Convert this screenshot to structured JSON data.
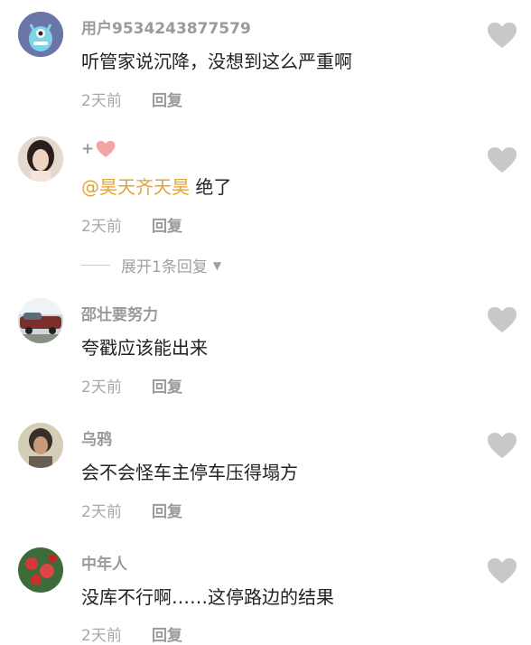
{
  "comments": [
    {
      "username": "用户9534243877579",
      "text": "听管家说沉降，没想到这么严重啊",
      "time": "2天前",
      "reply": "回复"
    },
    {
      "username": "+",
      "mention": "@昊天齐天昊",
      "text": " 绝了",
      "time": "2天前",
      "reply": "回复",
      "expand": "展开1条回复"
    },
    {
      "username": "邵壮要努力",
      "text": "夸戳应该能出来",
      "time": "2天前",
      "reply": "回复"
    },
    {
      "username": "乌鸦",
      "text": "会不会怪车主停车压得塌方",
      "time": "2天前",
      "reply": "回复"
    },
    {
      "username": "中年人",
      "text": "没库不行啊……这停路边的结果",
      "time": "2天前",
      "reply": "回复"
    }
  ],
  "colors": {
    "like_icon": "#c8c8c8",
    "mention": "#e0a53a"
  }
}
